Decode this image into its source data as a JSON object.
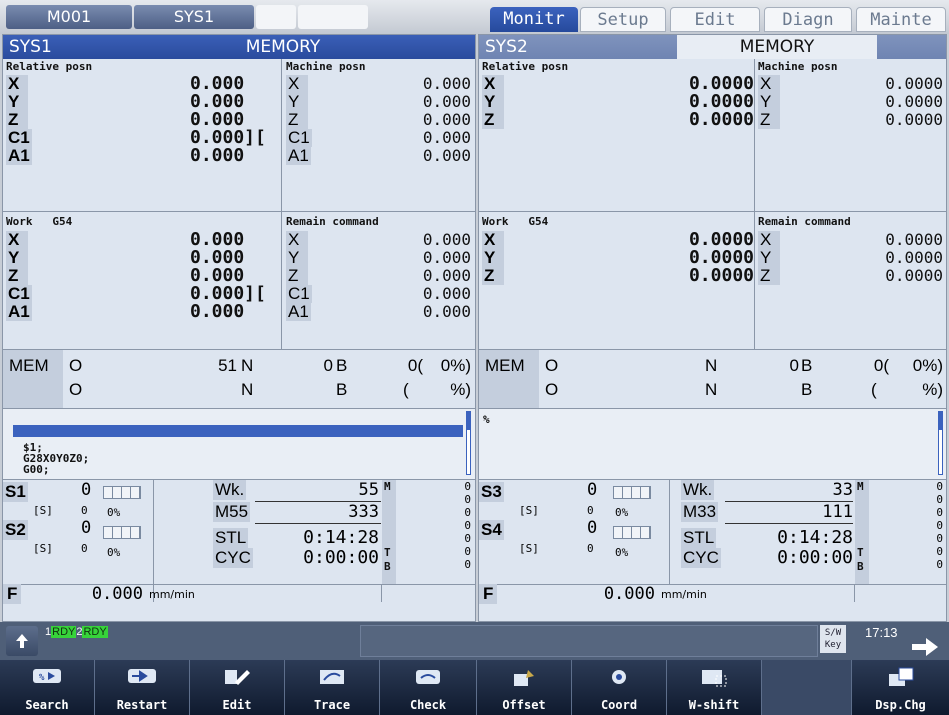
{
  "top": {
    "tab1": "M001",
    "tab2": "SYS1",
    "modes": [
      "Monitr",
      "Setup",
      "Edit",
      "Diagn",
      "Mainte"
    ]
  },
  "left": {
    "sys": "SYS1",
    "mode": "MEMORY",
    "rel_title": "Relative posn",
    "mach_title": "Machine posn",
    "work_title": "Work",
    "work_code": "G54",
    "remain_title": "Remain command",
    "axes": [
      "X",
      "Y",
      "Z",
      "C1",
      "A1"
    ],
    "rel_vals": [
      "0.000",
      "0.000",
      "0.000",
      "0.000][",
      "0.000"
    ],
    "mach_vals": [
      "0.000",
      "0.000",
      "0.000",
      "0.000",
      "0.000"
    ],
    "work_vals": [
      "0.000",
      "0.000",
      "0.000",
      "0.000][",
      "0.000"
    ],
    "remain_vals": [
      "0.000",
      "0.000",
      "0.000",
      "0.000",
      "0.000"
    ],
    "mem": "MEM",
    "o_label": "O",
    "o_val": "51",
    "n_label": "N",
    "n_val": "0",
    "b_label": "B",
    "b_val": "0(",
    "pct": "0%)",
    "o2": "O",
    "n2": "N",
    "b2": "B",
    "paren": "(",
    "pct2": "%)",
    "prog_lines": [
      "$1;",
      "G28X0Y0Z0;",
      "G00;"
    ],
    "s1": "S1",
    "s2": "S2",
    "s_unit": "[S]",
    "s1_val": "0",
    "s1_sub": "0",
    "s2_val": "0",
    "s2_sub": "0",
    "pct_small": "0%",
    "wk": "Wk.",
    "wk_val": "55",
    "m55": "M55",
    "m55_val": "333",
    "stl": "STL",
    "stl_val": "0:14:28",
    "cyc": "CYC",
    "cyc_val": "0:00:00",
    "m_letter": "M",
    "t_letter": "T",
    "b_letter": "B",
    "m_vals": [
      "0",
      "0",
      "0",
      "0",
      "0",
      "0",
      "0"
    ],
    "f": "F",
    "f_val": "0.000",
    "f_unit": "mm/min"
  },
  "right": {
    "sys": "SYS2",
    "mode": "MEMORY",
    "rel_title": "Relative posn",
    "mach_title": "Machine posn",
    "work_title": "Work",
    "work_code": "G54",
    "remain_title": "Remain command",
    "axes": [
      "X",
      "Y",
      "Z"
    ],
    "rel_vals": [
      "0.0000",
      "0.0000",
      "0.0000"
    ],
    "mach_vals": [
      "0.0000",
      "0.0000",
      "0.0000"
    ],
    "work_vals": [
      "0.0000",
      "0.0000",
      "0.0000"
    ],
    "remain_vals": [
      "0.0000",
      "0.0000",
      "0.0000"
    ],
    "mem": "MEM",
    "o_label": "O",
    "n_label": "N",
    "n_val": "0",
    "b_label": "B",
    "b_val": "0(",
    "pct": "0%)",
    "o2": "O",
    "n2": "N",
    "b2": "B",
    "paren": "(",
    "pct2": "%)",
    "prog_lines": [
      "%"
    ],
    "s3": "S3",
    "s4": "S4",
    "s_unit": "[S]",
    "s3_val": "0",
    "s3_sub": "0",
    "s4_val": "0",
    "s4_sub": "0",
    "pct_small": "0%",
    "wk": "Wk.",
    "wk_val": "33",
    "m33": "M33",
    "m33_val": "111",
    "stl": "STL",
    "stl_val": "0:14:28",
    "cyc": "CYC",
    "cyc_val": "0:00:00",
    "m_letter": "M",
    "t_letter": "T",
    "b_letter": "B",
    "m_vals": [
      "0",
      "0",
      "0",
      "0",
      "0",
      "0",
      "0"
    ],
    "f": "F",
    "f_val": "0.000",
    "f_unit": "mm/min"
  },
  "status": {
    "rdy1": "1",
    "rdy1_txt": "RDY",
    "rdy2": "2",
    "rdy2_txt": "RDY",
    "sw": "S/W",
    "key": "Key",
    "time": "17:13"
  },
  "fkeys": [
    "Search",
    "Restart",
    "Edit",
    "Trace",
    "Check",
    "Offset",
    "Coord",
    "W-shift",
    "",
    "Dsp.Chg"
  ],
  "colors": {
    "header": "#2a4b9d",
    "active_mode": "#2a4b9d",
    "panel": "#dde5f0",
    "rdy": "#37d33a"
  }
}
